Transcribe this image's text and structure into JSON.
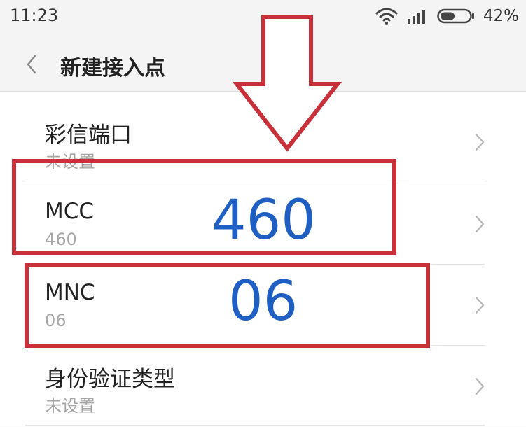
{
  "status_bar": {
    "time": "11:23",
    "battery_percent": "42%",
    "icons": [
      "wifi-icon",
      "signal-icon",
      "battery-icon"
    ]
  },
  "header": {
    "back_icon": "chevron-left-icon",
    "title": "新建接入点"
  },
  "list": {
    "items": [
      {
        "title": "彩信端口",
        "value": "未设置"
      },
      {
        "title": "MCC",
        "value": "460"
      },
      {
        "title": "MNC",
        "value": "06"
      },
      {
        "title": "身份验证类型",
        "value": "未设置"
      }
    ]
  },
  "annotations": {
    "mcc_number": "460",
    "mnc_number": "06",
    "arrow_icon": "down-arrow-icon",
    "box_color": "#c8303a",
    "number_color": "#1f5fc4"
  }
}
